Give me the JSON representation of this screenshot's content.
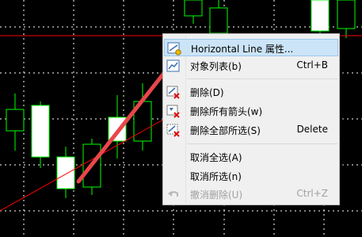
{
  "colors": {
    "chart_bg": "#000000",
    "grid": "#ffffff",
    "candle_outline": "#00ff00",
    "candle_bull_fill": "#000000",
    "candle_bear_fill": "#ffffff",
    "horizontal_line": "#ff0000",
    "trend_line": "#ff0000",
    "annotation_arrow": "#e8474a",
    "menu_bg": "#f0f0f0",
    "menu_highlight": "#cce4f7"
  },
  "context_menu": {
    "items": [
      {
        "label": "Horizontal Line 属性...",
        "shortcut": "",
        "icon": "properties-icon",
        "highlighted": true,
        "disabled": false
      },
      {
        "label": "对象列表(b)",
        "shortcut": "Ctrl+B",
        "icon": "object-list-icon",
        "highlighted": false,
        "disabled": false
      },
      {
        "label": "删除(D)",
        "shortcut": "",
        "icon": "delete-icon",
        "highlighted": false,
        "disabled": false
      },
      {
        "label": "删除所有箭头(w)",
        "shortcut": "",
        "icon": "delete-arrows-icon",
        "highlighted": false,
        "disabled": false
      },
      {
        "label": "删除全部所选(S)",
        "shortcut": "Delete",
        "icon": "delete-selected-icon",
        "highlighted": false,
        "disabled": false
      },
      {
        "label": "取消全选(A)",
        "shortcut": "",
        "icon": "",
        "highlighted": false,
        "disabled": false
      },
      {
        "label": "取消所选(n)",
        "shortcut": "",
        "icon": "",
        "highlighted": false,
        "disabled": false
      },
      {
        "label": "撤消删除(U)",
        "shortcut": "Ctrl+Z",
        "icon": "undo-icon",
        "highlighted": false,
        "disabled": true
      }
    ]
  }
}
